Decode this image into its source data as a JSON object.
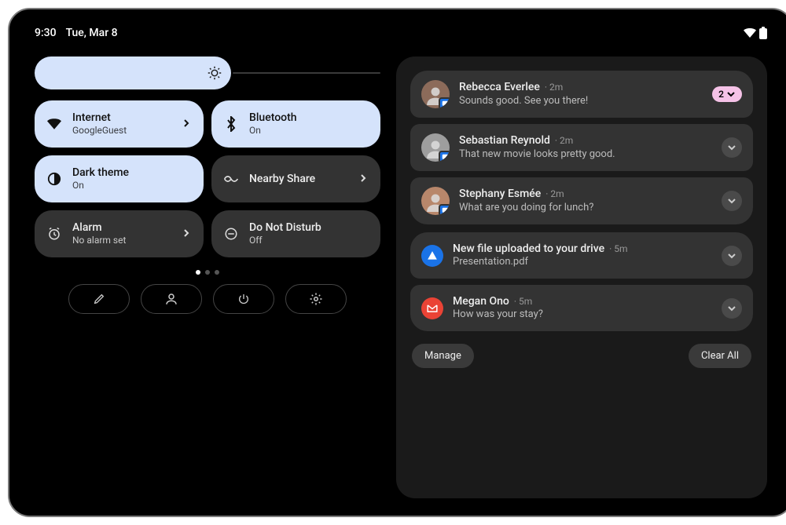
{
  "status": {
    "time": "9:30",
    "date": "Tue, Mar 8"
  },
  "brightness": {
    "percent": 56
  },
  "tiles": [
    {
      "icon": "wifi",
      "title": "Internet",
      "subtitle": "GoogleGuest",
      "active": true,
      "chevron": true
    },
    {
      "icon": "bluetooth",
      "title": "Bluetooth",
      "subtitle": "On",
      "active": true,
      "chevron": false
    },
    {
      "icon": "darkmode",
      "title": "Dark theme",
      "subtitle": "On",
      "active": true,
      "chevron": false
    },
    {
      "icon": "nearby",
      "title": "Nearby Share",
      "subtitle": "",
      "active": false,
      "chevron": true
    },
    {
      "icon": "alarm",
      "title": "Alarm",
      "subtitle": "No alarm set",
      "active": false,
      "chevron": true
    },
    {
      "icon": "dnd",
      "title": "Do Not Disturb",
      "subtitle": "Off",
      "active": false,
      "chevron": false
    }
  ],
  "pager": {
    "count": 3,
    "active": 0
  },
  "footer_icons": [
    "edit",
    "user",
    "power",
    "settings"
  ],
  "notifications": {
    "group1": [
      {
        "avatar_color": "#8c6b5a",
        "badge": true,
        "title": "Rebecca Everlee",
        "meta": "· 2m",
        "text": "Sounds good. See you there!",
        "count": "2"
      },
      {
        "avatar_color": "#9e9e9e",
        "badge": true,
        "title": "Sebastian Reynold",
        "meta": "· 2m",
        "text": "That new movie looks pretty good."
      },
      {
        "avatar_color": "#b8876b",
        "badge": true,
        "title": "Stephany Esmée",
        "meta": "· 2m",
        "text": "What are you doing for lunch?"
      }
    ],
    "group2": [
      {
        "icon_bg": "#1a73e8",
        "icon_name": "drive",
        "title": "New file uploaded to your drive",
        "meta": "· 5m",
        "text": "Presentation.pdf"
      },
      {
        "icon_bg": "#ea4335",
        "icon_name": "gmail",
        "title": "Megan Ono",
        "meta": "· 5m",
        "text": "How was your stay?"
      }
    ],
    "actions": {
      "manage": "Manage",
      "clear": "Clear All"
    }
  }
}
